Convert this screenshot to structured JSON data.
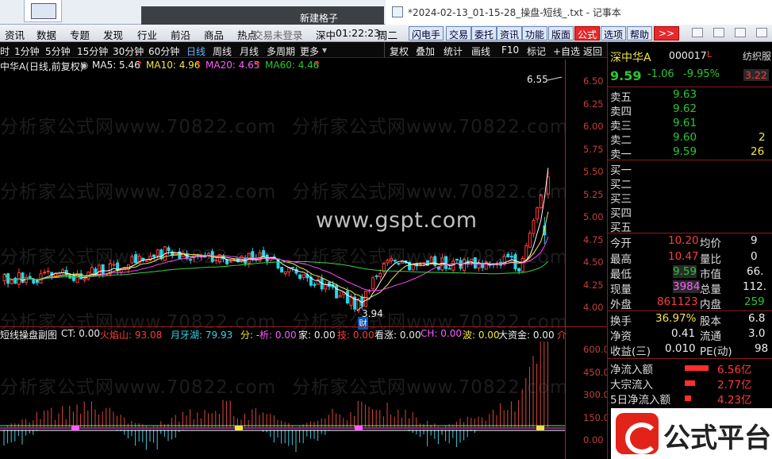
{
  "window": {
    "dark_title": "新建格子",
    "notepad_title": "*2024-02-13_01-15-28_操盘-短线_.txt - 记事本"
  },
  "menubar": {
    "items": [
      "资讯",
      "数据",
      "专题",
      "发现",
      "行业",
      "前沿",
      "商品",
      "热点"
    ],
    "status": "交易未登录",
    "market": "深中",
    "time": "01:22:23",
    "weekday": "周二",
    "buttons": [
      "闪电手",
      "交易",
      "委托",
      "资讯",
      "功能",
      "版面",
      "公式",
      "选项",
      "帮助"
    ],
    "more": ">>"
  },
  "toolbar": {
    "timeframes": [
      "时",
      "1分钟",
      "5分钟",
      "15分钟",
      "30分钟",
      "60分钟",
      "日线",
      "周线",
      "月线",
      "多周期",
      "更多"
    ],
    "active_timeframe": "日线",
    "tools": [
      "复权",
      "叠加",
      "统计",
      "画线",
      "F10",
      "标记",
      "+自选",
      "返回"
    ]
  },
  "ma_line": {
    "title": "中华A(日线,前复权)",
    "ma5": "MA5: 5.46",
    "ma10": "MA10: 4.96",
    "ma20": "MA20: 4.65",
    "ma60": "MA60: 4.46",
    "arrow": "↑"
  },
  "main_axis": [
    "6.50",
    "6.25",
    "6.00",
    "5.75",
    "5.50",
    "5.25",
    "5.00",
    "4.75",
    "4.50",
    "4.25",
    "4.00"
  ],
  "annotations": {
    "high": "6.55",
    "low": "3.94",
    "low_tag": "财"
  },
  "sub_line": {
    "name": "短线操盘副图",
    "ct": "CT: 0.00",
    "huoyan": "火焰山: 93.08",
    "yueya": "月牙湖: 79.93",
    "fen": "分: -",
    "xi": "析: 0.00",
    "jia": "家: 0.00",
    "ji": "技: 0.00",
    "kanzhang": "看涨: 0.00",
    "ch": "CH: 0.00",
    "bo": "波: 0.00",
    "dazijin": "大资金: 0.00",
    "jie": "介"
  },
  "sub_axis": [
    "600.00",
    "450.00",
    "300.00",
    "150.00",
    "0.00"
  ],
  "stock": {
    "name": "深中华A",
    "code": "000017",
    "tag": "L",
    "sector": "纺织服",
    "price": "9.59",
    "change": "-1.06",
    "pct": "-9.95%",
    "side_val": "3.22"
  },
  "order_book": {
    "sells": [
      {
        "label": "卖五",
        "price": "9.63",
        "vol": ""
      },
      {
        "label": "卖四",
        "price": "9.62",
        "vol": ""
      },
      {
        "label": "卖三",
        "price": "9.61",
        "vol": ""
      },
      {
        "label": "卖二",
        "price": "9.60",
        "vol": "2"
      },
      {
        "label": "卖一",
        "price": "9.59",
        "vol": "26"
      }
    ],
    "buys": [
      "买一",
      "买二",
      "买三",
      "买四",
      "买五"
    ]
  },
  "stats": [
    {
      "k": "今开",
      "v": "10.20",
      "k2": "均价",
      "v2": "9"
    },
    {
      "k": "最高",
      "v": "10.47",
      "k2": "量比",
      "v2": "0"
    },
    {
      "k": "最低",
      "v": "9.59",
      "k2": "市值",
      "v2": "66."
    },
    {
      "k": "现量",
      "v": "3984",
      "k2": "总量",
      "v2": "112."
    },
    {
      "k": "外盘",
      "v": "861123",
      "k2": "内盘",
      "v2": "259"
    }
  ],
  "stats2": [
    {
      "k": "换手",
      "v": "36.97%",
      "k2": "股本",
      "v2": "6.8"
    },
    {
      "k": "净资",
      "v": "0.41",
      "k2": "流通",
      "v2": "3.0"
    },
    {
      "k": "收益(三)",
      "v": "0.010",
      "k2": "PE(动)",
      "v2": "98"
    }
  ],
  "flows": [
    {
      "k": "净流入额",
      "v": "6.56亿",
      "bar": 0.75
    },
    {
      "k": "大宗流入",
      "v": "2.77亿",
      "bar": 0.32
    },
    {
      "k": "5日净流入额",
      "v": "4.23亿",
      "bar": 0.2
    }
  ],
  "watermark": "分析家公式网www.70822.com",
  "center_watermark": "www.gspt.com",
  "brand": "公式平台",
  "colors": {
    "ma5": "#ffffff",
    "ma10": "#f2e94a",
    "ma20": "#ff47ff",
    "ma60": "#36d33b",
    "up": "#ff3b3b",
    "down": "#27d3e6"
  }
}
